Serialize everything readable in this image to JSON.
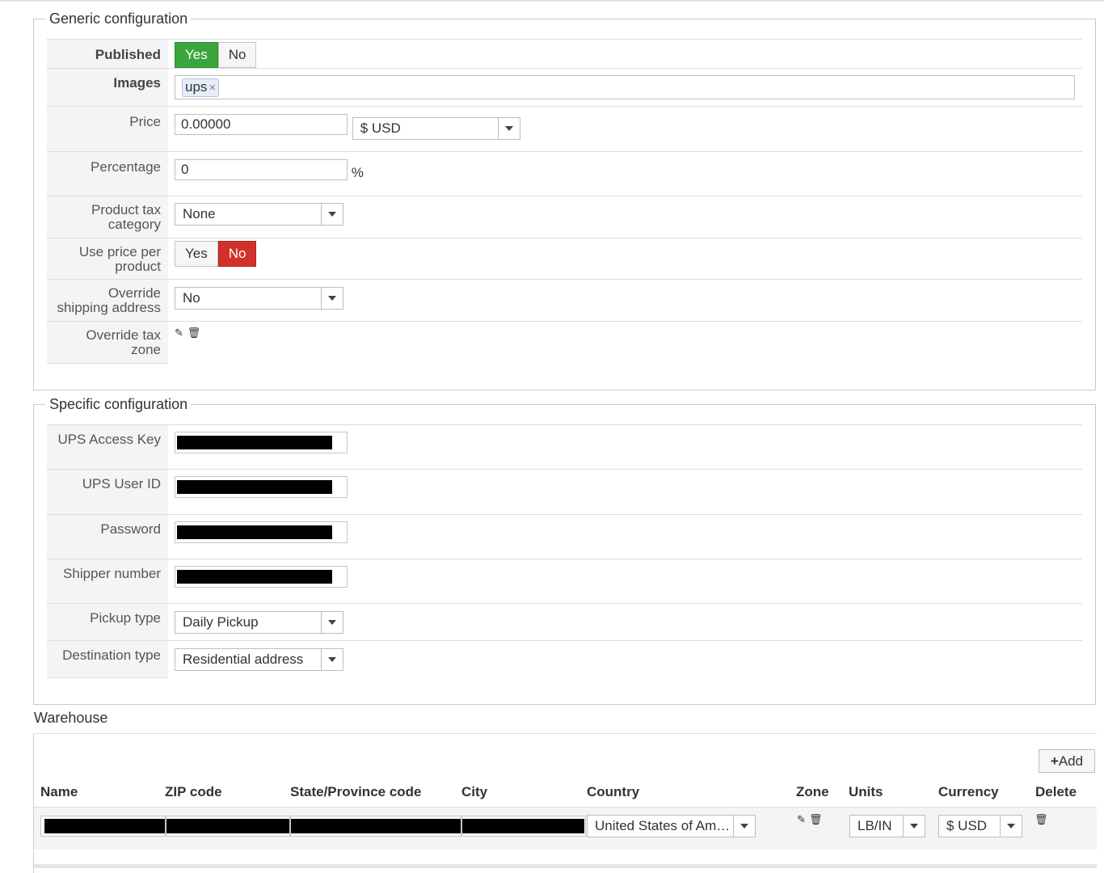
{
  "generic": {
    "legend": "Generic configuration",
    "published": {
      "label": "Published",
      "yes": "Yes",
      "no": "No",
      "value": "Yes"
    },
    "images": {
      "label": "Images",
      "tag": "ups",
      "tag_remove": "×"
    },
    "price": {
      "label": "Price",
      "value": "0.00000",
      "currency": "$ USD"
    },
    "percentage": {
      "label": "Percentage",
      "value": "0",
      "unit": "%"
    },
    "tax_category": {
      "label_line1": "Product tax",
      "label_line2": "category",
      "value": "None"
    },
    "price_per_product": {
      "label_line1": "Use price per",
      "label_line2": "product",
      "yes": "Yes",
      "no": "No",
      "value": "No"
    },
    "override_shipping": {
      "label_line1": "Override",
      "label_line2": "shipping address",
      "value": "No"
    },
    "override_tax_zone": {
      "label_line1": "Override tax",
      "label_line2": "zone",
      "edit_icon": "pencil-icon",
      "delete_icon": "trash-icon"
    }
  },
  "specific": {
    "legend": "Specific configuration",
    "access_key": {
      "label": "UPS Access Key"
    },
    "user_id": {
      "label": "UPS User ID"
    },
    "password": {
      "label": "Password"
    },
    "shipper_number": {
      "label": "Shipper number"
    },
    "pickup_type": {
      "label": "Pickup type",
      "value": "Daily Pickup"
    },
    "destination_type": {
      "label": "Destination type",
      "value": "Residential address"
    }
  },
  "warehouse": {
    "title": "Warehouse",
    "add_button": "Add",
    "columns": [
      "Name",
      "ZIP code",
      "State/Province code",
      "City",
      "Country",
      "Zone",
      "Units",
      "Currency",
      "Delete"
    ],
    "row": {
      "country": "United States of Am…",
      "units": "LB/IN",
      "currency": "$ USD"
    }
  },
  "colors": {
    "yes_active": "#3ba53d",
    "no_active": "#d0322b"
  }
}
